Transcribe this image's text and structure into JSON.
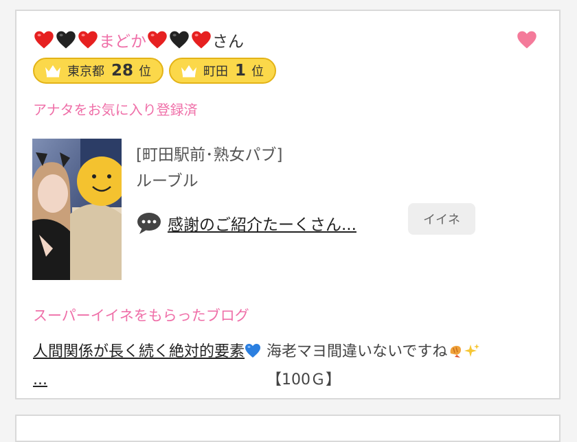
{
  "profile": {
    "name_text": "まどか",
    "name_suffix": "さん",
    "favorite_icon": "heart-icon"
  },
  "rankings": [
    {
      "area": "東京都",
      "rank": "28",
      "unit": "位",
      "icon": "crown-icon"
    },
    {
      "area": "町田",
      "rank": "1",
      "unit": "位",
      "icon": "crown-icon"
    }
  ],
  "favorite_status": "アナタをお気に入り登録済",
  "post": {
    "shop": "[町田駅前･熟女パブ]",
    "staff_name": "ルーブル",
    "comment": "感謝のご紹介たーくさん...",
    "comment_icon": "speech-bubble-icon",
    "like_label": "イイネ"
  },
  "super_like_section": {
    "title": "スーパーイイネをもらったブログ",
    "blog_title_part1": "人間関係が長く続く絶対的要",
    "blog_title_part2": "素",
    "blog_title_ellipsis": "...",
    "comment_text": "海老マヨ間違いないですね",
    "reward": "【100Ｇ】"
  },
  "colors": {
    "accent_pink": "#ef6fa8",
    "badge_yellow": "#fbd84a",
    "heart_red": "#e62020",
    "heart_black": "#222222",
    "favorite_heart": "#f47a9a"
  }
}
